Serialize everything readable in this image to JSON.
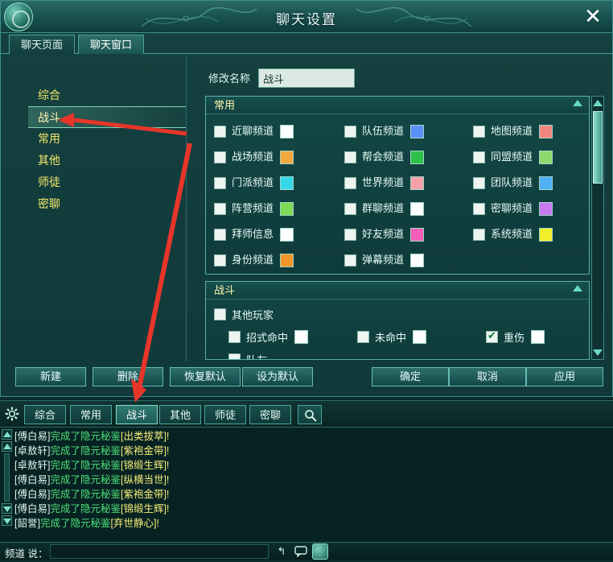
{
  "window": {
    "title": "聊天设置",
    "close_icon": "close-icon",
    "logo_icon": "app-logo-icon"
  },
  "tabs": [
    {
      "label": "聊天页面",
      "active": false
    },
    {
      "label": "聊天窗口",
      "active": true
    }
  ],
  "sidebar": {
    "items": [
      {
        "label": "综合",
        "selected": false
      },
      {
        "label": "战斗",
        "selected": true
      },
      {
        "label": "常用",
        "selected": false
      },
      {
        "label": "其他",
        "selected": false
      },
      {
        "label": "师徒",
        "selected": false
      },
      {
        "label": "密聊",
        "selected": false
      }
    ]
  },
  "name_row": {
    "label": "修改名称",
    "value": "战斗",
    "placeholder": ""
  },
  "groups": [
    {
      "id": "common",
      "title": "常用",
      "collapse_icon": "chevron-up-icon",
      "channels": [
        {
          "label": "近聊频道",
          "checked": false,
          "color": "#ffffff"
        },
        {
          "label": "队伍频道",
          "checked": false,
          "color": "#5b8ff9"
        },
        {
          "label": "地图频道",
          "checked": false,
          "color": "#f0867f"
        },
        {
          "label": "战场频道",
          "checked": false,
          "color": "#f2a83c"
        },
        {
          "label": "帮会频道",
          "checked": false,
          "color": "#2fc04a"
        },
        {
          "label": "同盟频道",
          "checked": false,
          "color": "#8fd86a"
        },
        {
          "label": "门派频道",
          "checked": false,
          "color": "#36d8e8"
        },
        {
          "label": "世界频道",
          "checked": false,
          "color": "#f4a0a8"
        },
        {
          "label": "团队频道",
          "checked": false,
          "color": "#4fb0f5"
        },
        {
          "label": "阵营频道",
          "checked": false,
          "color": "#7ed957"
        },
        {
          "label": "群聊频道",
          "checked": false,
          "color": "#ffffff"
        },
        {
          "label": "密聊频道",
          "checked": false,
          "color": "#c879f0"
        },
        {
          "label": "拜师信息",
          "checked": false,
          "color": "#ffffff"
        },
        {
          "label": "好友频道",
          "checked": false,
          "color": "#f35fb8"
        },
        {
          "label": "系统频道",
          "checked": false,
          "color": "#f2ef2a"
        },
        {
          "label": "身份频道",
          "checked": false,
          "color": "#f2952a"
        },
        {
          "label": "弹幕频道",
          "checked": false,
          "color": "#ffffff"
        }
      ]
    },
    {
      "id": "battle",
      "title": "战斗",
      "collapse_icon": "chevron-up-icon",
      "rows": [
        {
          "label": "其他玩家",
          "checked": false,
          "indent": 0,
          "swatch": null
        },
        {
          "label": "招式命中",
          "checked": false,
          "indent": 1,
          "swatch": "#ffffff"
        },
        {
          "label": "未命中",
          "checked": false,
          "indent": 1,
          "swatch": "#ffffff"
        },
        {
          "label": "重伤",
          "checked": true,
          "indent": 1,
          "swatch": "#ffffff"
        },
        {
          "label": "队友",
          "checked": false,
          "indent": 1,
          "swatch": null
        }
      ]
    }
  ],
  "scrollbar": {
    "up_icon": "chevron-up-icon",
    "down_icon": "chevron-down-icon"
  },
  "buttons": [
    {
      "id": "b-new",
      "label": "新建"
    },
    {
      "id": "b-del",
      "label": "删除"
    },
    {
      "id": "b-rest",
      "label": "恢复默认"
    },
    {
      "id": "b-setdef",
      "label": "设为默认"
    },
    {
      "id": "b-ok",
      "label": "确定"
    },
    {
      "id": "b-cancel",
      "label": "取消"
    },
    {
      "id": "b-apply",
      "label": "应用"
    }
  ],
  "chatbar": {
    "gear_icon": "gear-icon",
    "search_icon": "search-icon",
    "tabs": [
      {
        "label": "综合",
        "active": false
      },
      {
        "label": "常用",
        "active": false
      },
      {
        "label": "战斗",
        "active": true
      },
      {
        "label": "其他",
        "active": false
      },
      {
        "label": "师徒",
        "active": false
      },
      {
        "label": "密聊",
        "active": false
      }
    ]
  },
  "chatlog": {
    "lines": [
      {
        "name": "[傅白易]",
        "mid": "完成了隐元秘鉴",
        "item": "[出类拔萃]!"
      },
      {
        "name": "[卓敖轩]",
        "mid": "完成了隐元秘鉴",
        "item": "[紫袍金带]!"
      },
      {
        "name": "[卓敖轩]",
        "mid": "完成了隐元秘鉴",
        "item": "[锦缎生辉]!"
      },
      {
        "name": "[傅白易]",
        "mid": "完成了隐元秘鉴",
        "item": "[纵横当世]!"
      },
      {
        "name": "[傅白易]",
        "mid": "完成了隐元秘鉴",
        "item": "[紫袍金带]!"
      },
      {
        "name": "[傅白易]",
        "mid": "完成了隐元秘鉴",
        "item": "[锦缎生辉]!"
      },
      {
        "name": "[韶誉]",
        "mid": "完成了隐元秘鉴",
        "item": "[弃世静心]!"
      }
    ]
  },
  "inputrow": {
    "channel_label": "频道",
    "say_label": "说：",
    "value": "",
    "icons": [
      "undo-icon",
      "chat-bubble-icon",
      "emoji-icon"
    ]
  },
  "annotations": {
    "arrow_color": "#e8352a",
    "arrows": 2
  }
}
